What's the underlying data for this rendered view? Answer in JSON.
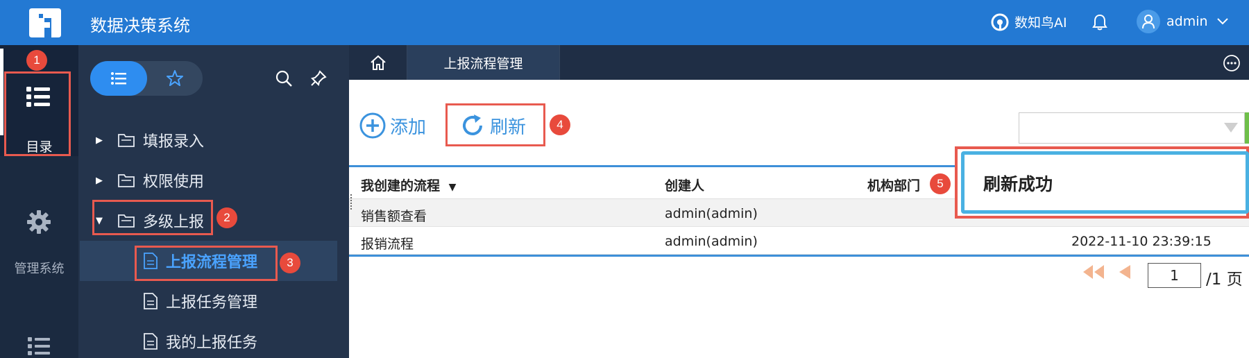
{
  "app": {
    "title": "数据决策系统"
  },
  "header": {
    "ai_label": "数知鸟AI",
    "username": "admin"
  },
  "nav": {
    "items": [
      {
        "label": "目录"
      },
      {
        "label": "管理系统"
      }
    ]
  },
  "tree": {
    "items": [
      {
        "label": "填报录入"
      },
      {
        "label": "权限使用"
      },
      {
        "label": "多级上报"
      },
      {
        "label": "上报流程管理"
      },
      {
        "label": "上报任务管理"
      },
      {
        "label": "我的上报任务"
      }
    ]
  },
  "tabs": {
    "active": "上报流程管理"
  },
  "toolbar": {
    "add_label": "添加",
    "refresh_label": "刷新"
  },
  "grid": {
    "headers": [
      "我创建的流程",
      "创建人",
      "机构部门"
    ],
    "rows": [
      {
        "name": "销售额查看",
        "creator": "admin(admin)",
        "time": ""
      },
      {
        "name": "报销流程",
        "creator": "admin(admin)",
        "time": "2022-11-10 23:39:15"
      }
    ]
  },
  "pager": {
    "current": "1",
    "total": "/1 页"
  },
  "toast": {
    "message": "刷新成功"
  },
  "annotations": [
    "1",
    "2",
    "3",
    "4",
    "5"
  ],
  "colors": {
    "header": "#2379d3",
    "nav": "#1b2a40",
    "tree": "#24344c",
    "accent": "#3b93de",
    "highlight": "#e85a4f"
  }
}
